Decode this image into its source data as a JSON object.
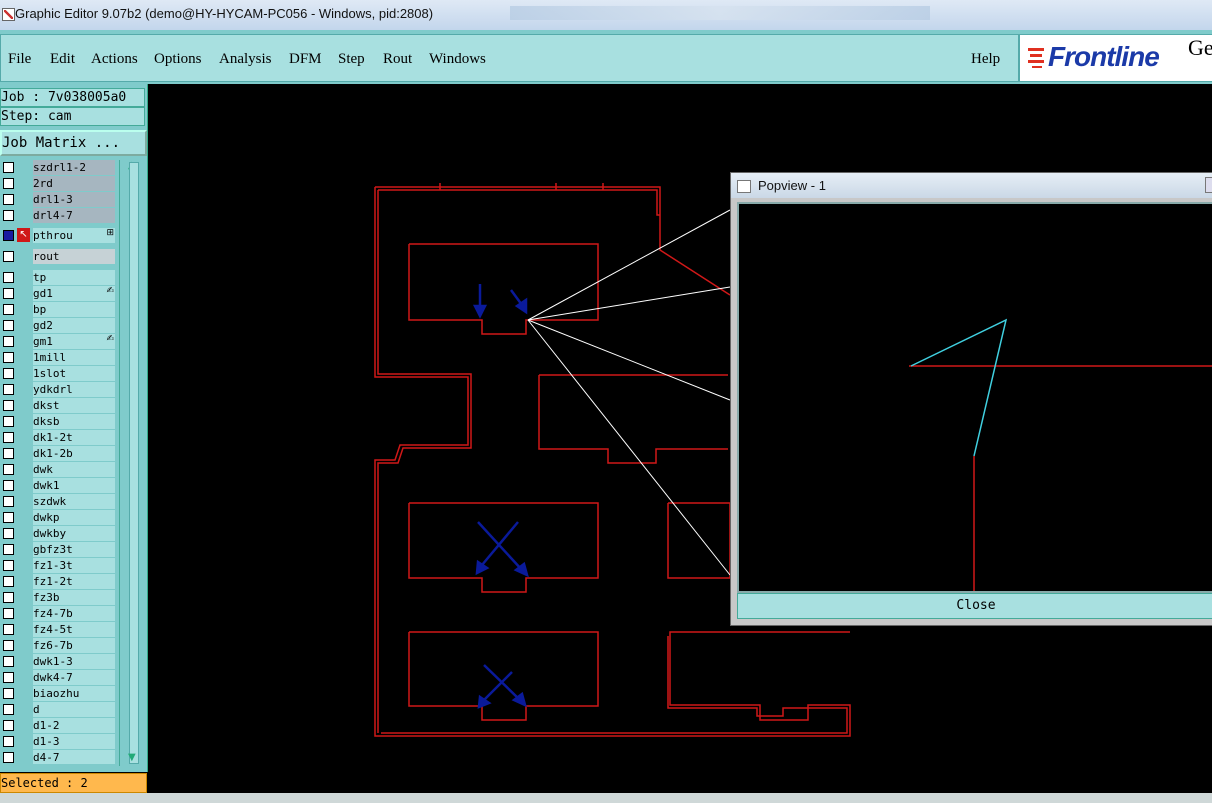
{
  "window": {
    "title": "Graphic Editor 9.07b2 (demo@HY-HYCAM-PC056 - Windows, pid:2808)"
  },
  "menu": {
    "items": [
      "File",
      "Edit",
      "Actions",
      "Options",
      "Analysis",
      "DFM",
      "Step",
      "Rout",
      "Windows"
    ],
    "help": "Help"
  },
  "logo": {
    "brand": "Frontline",
    "suffix": "Ge"
  },
  "panel": {
    "job": "Job : 7v038005a0",
    "step": "Step: cam",
    "job_matrix": "Job Matrix ...",
    "selected": "Selected : 2"
  },
  "layers": [
    {
      "name": "szdrl1-2",
      "style": "gray"
    },
    {
      "name": "2rd",
      "style": "gray"
    },
    {
      "name": "drl1-3",
      "style": "gray"
    },
    {
      "name": "drl4-7",
      "style": "gray"
    },
    {
      "name": "pthrou",
      "style": "active"
    },
    {
      "name": "rout",
      "style": "lgray"
    },
    {
      "name": "tp",
      "style": "normal"
    },
    {
      "name": "gd1",
      "style": "normal",
      "mark": "hand"
    },
    {
      "name": "bp",
      "style": "normal"
    },
    {
      "name": "gd2",
      "style": "normal"
    },
    {
      "name": "gm1",
      "style": "normal",
      "mark": "hand"
    },
    {
      "name": "1mill",
      "style": "normal"
    },
    {
      "name": "1slot",
      "style": "normal"
    },
    {
      "name": "ydkdrl",
      "style": "normal"
    },
    {
      "name": "dkst",
      "style": "normal"
    },
    {
      "name": "dksb",
      "style": "normal"
    },
    {
      "name": "dk1-2t",
      "style": "normal"
    },
    {
      "name": "dk1-2b",
      "style": "normal"
    },
    {
      "name": "dwk",
      "style": "normal"
    },
    {
      "name": "dwk1",
      "style": "normal"
    },
    {
      "name": "szdwk",
      "style": "normal"
    },
    {
      "name": "dwkp",
      "style": "normal"
    },
    {
      "name": "dwkby",
      "style": "normal"
    },
    {
      "name": "gbfz3t",
      "style": "normal"
    },
    {
      "name": "fz1-3t",
      "style": "normal"
    },
    {
      "name": "fz1-2t",
      "style": "normal"
    },
    {
      "name": "fz3b",
      "style": "normal"
    },
    {
      "name": "fz4-7b",
      "style": "normal"
    },
    {
      "name": "fz4-5t",
      "style": "normal"
    },
    {
      "name": "fz6-7b",
      "style": "normal"
    },
    {
      "name": "dwk1-3",
      "style": "normal"
    },
    {
      "name": "dwk4-7",
      "style": "normal"
    },
    {
      "name": "biaozhu",
      "style": "normal"
    },
    {
      "name": "d",
      "style": "normal"
    },
    {
      "name": "d1-2",
      "style": "normal"
    },
    {
      "name": "d1-3",
      "style": "normal"
    },
    {
      "name": "d4-7",
      "style": "normal"
    }
  ],
  "popview": {
    "title": "Popview - 1",
    "close_label": "Close"
  },
  "colors": {
    "panel": "#7fcbcb",
    "panel_light": "#a8e0e0",
    "rout_red": "#d01818",
    "arrow_blue": "#0a1a9a",
    "cyan_line": "#40d0e0",
    "selected_bar": "#ffb84d"
  }
}
